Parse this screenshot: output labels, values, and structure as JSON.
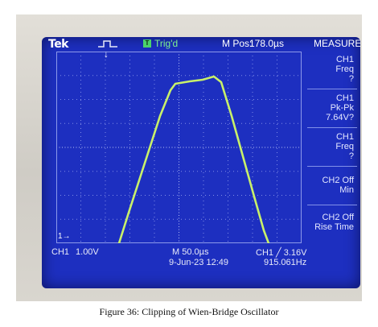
{
  "scope": {
    "brand": "Tek",
    "acquisition_icon": "run-pulse-icon",
    "trigger_indicator": "T",
    "trigger_status": "Trig'd",
    "position_label": "M Pos:",
    "position_value": "178.0µs",
    "menu_title": "MEASURE",
    "measurements": [
      {
        "channel": "CH1",
        "type": "Freq",
        "value": "?"
      },
      {
        "channel": "CH1",
        "type": "Pk-Pk",
        "value": "7.64V?"
      },
      {
        "channel": "CH1",
        "type": "Freq",
        "value": "?"
      },
      {
        "channel": "CH2 Off",
        "type": "Min",
        "value": ""
      },
      {
        "channel": "CH2 Off",
        "type": "Rise Time",
        "value": ""
      }
    ],
    "channel_label": "CH1",
    "channel_scale": "1.00V",
    "timebase": "M 50.0µs",
    "date": "9-Jun-23",
    "time": "12:49",
    "trigger_readout": "CH1 ╱ 3.16V",
    "frequency": "915.061Hz",
    "ground_marker": "1→",
    "colors": {
      "screen": "#1d2fc0",
      "trace": "#c8f06a",
      "grid": "#9aa6f0"
    }
  },
  "caption": "Figure 36: Clipping of Wien-Bridge Oscillator"
}
